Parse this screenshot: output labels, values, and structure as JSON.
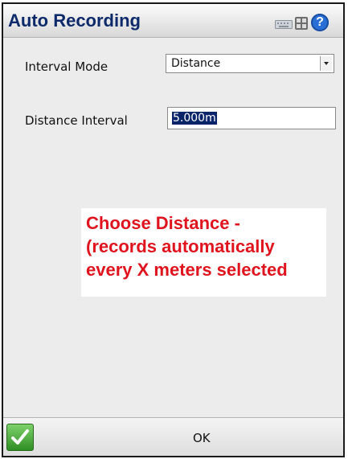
{
  "window": {
    "title": "Auto Recording",
    "icons": [
      "keyboard-icon",
      "grid-icon",
      "help-icon"
    ],
    "help_glyph": "?"
  },
  "form": {
    "interval_mode_label": "Interval Mode",
    "interval_mode_value": "Distance",
    "distance_interval_label": "Distance Interval",
    "distance_interval_value": "5.000m"
  },
  "callout": {
    "line1": "Choose Distance -",
    "line2": "(records automatically",
    "line3": "every X meters selected",
    "color": "#e0141e"
  },
  "footer": {
    "ok_label": "OK"
  }
}
